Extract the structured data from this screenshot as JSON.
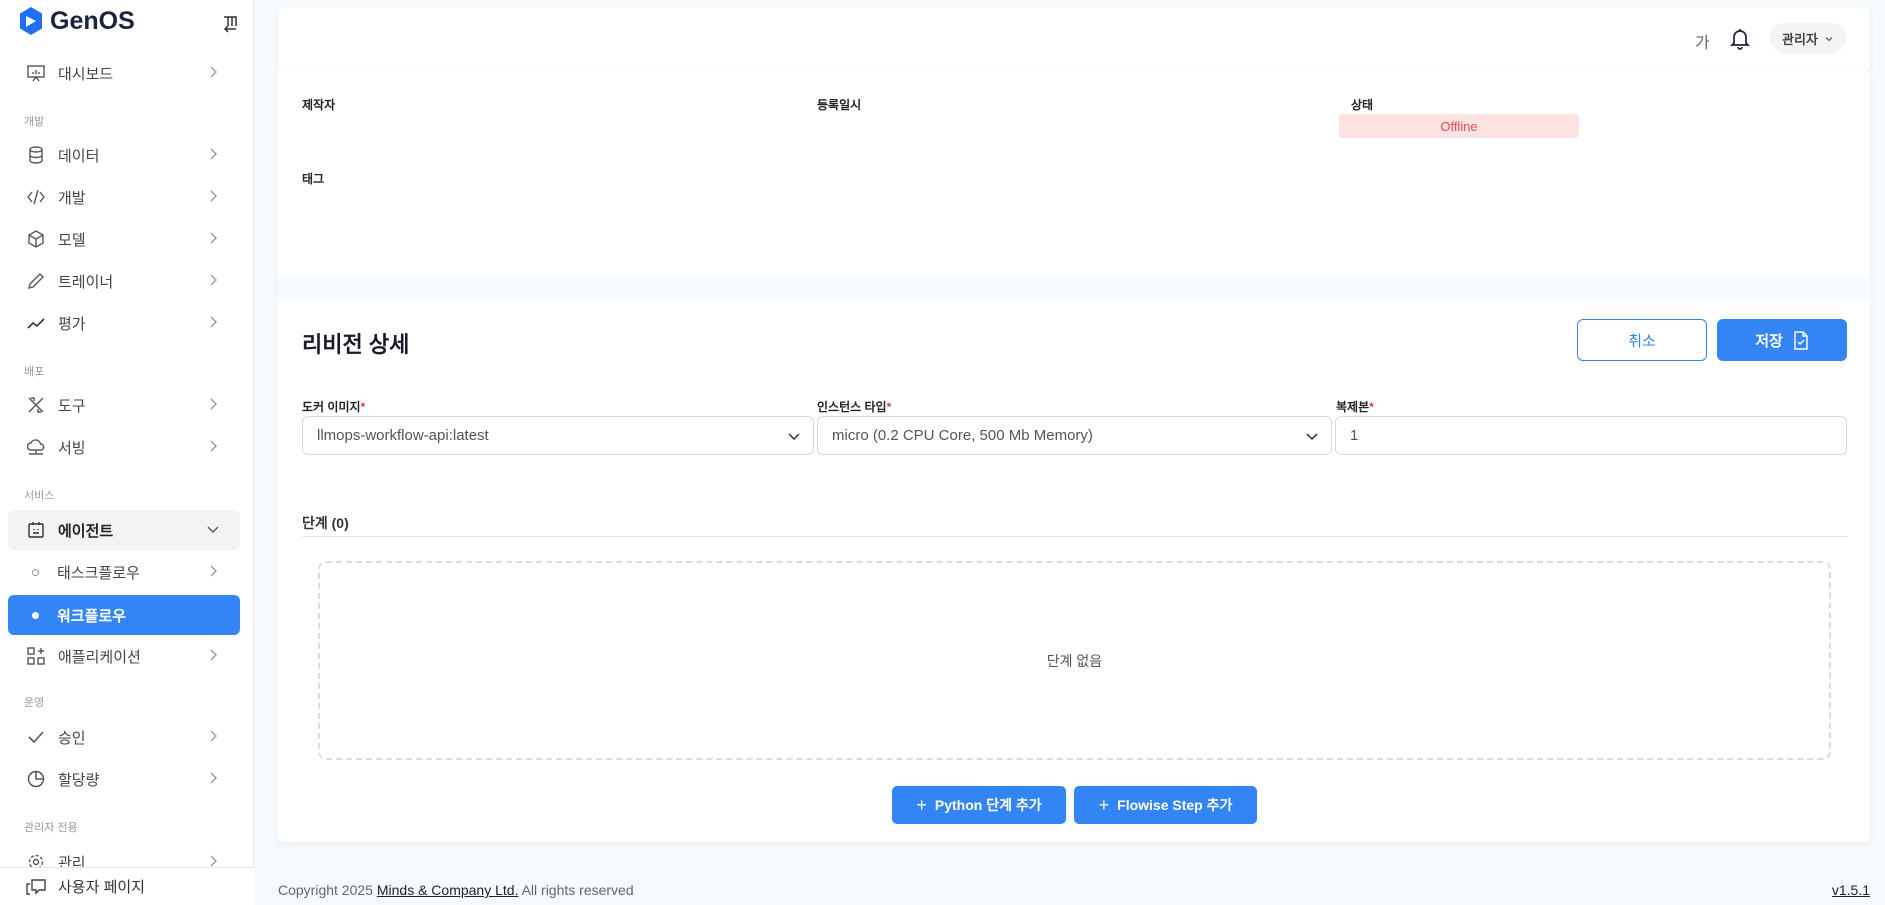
{
  "app": {
    "name": "GenOS"
  },
  "sidebar": {
    "dashboard": "대시보드",
    "sections": {
      "dev": "개발",
      "deploy": "배포",
      "service": "서비스",
      "ops": "운영",
      "admin": "관리자 전용"
    },
    "items": {
      "data": "데이터",
      "develop": "개발",
      "model": "모델",
      "trainer": "트레이너",
      "eval": "평가",
      "tools": "도구",
      "serving": "서빙",
      "agent": "에이전트",
      "taskflow": "태스크플로우",
      "workflow": "워크플로우",
      "application": "애플리케이션",
      "approval": "승인",
      "quota": "할당량",
      "manage": "관리"
    },
    "user_page": "사용자 페이지"
  },
  "header": {
    "font_size_label": "가",
    "user": "관리자"
  },
  "info": {
    "creator_label": "제작자",
    "registered_label": "등록일시",
    "status_label": "상태",
    "status": "Offline",
    "tag_label": "태그"
  },
  "revision": {
    "title": "리비전 상세",
    "cancel": "취소",
    "save": "저장",
    "docker_label": "도커 이미지",
    "docker_value": "llmops-workflow-api:latest",
    "instance_label": "인스턴스 타입",
    "instance_value": "micro (0.2 CPU Core, 500 Mb Memory)",
    "replica_label": "복제본",
    "replica_value": "1",
    "required": "*",
    "steps_title": "단계 (0)",
    "steps_empty": "단계 없음",
    "add_python": "Python 단계 추가",
    "add_flowise": "Flowise Step 추가"
  },
  "footer": {
    "copyright_prefix": "Copyright 2025 ",
    "company": "Minds & Company Ltd.",
    "copyright_suffix": " All rights reserved",
    "version": "v1.5.1"
  },
  "colors": {
    "primary": "#3385f6",
    "offline_bg": "#fde2e2",
    "offline_text": "#e5484d"
  }
}
